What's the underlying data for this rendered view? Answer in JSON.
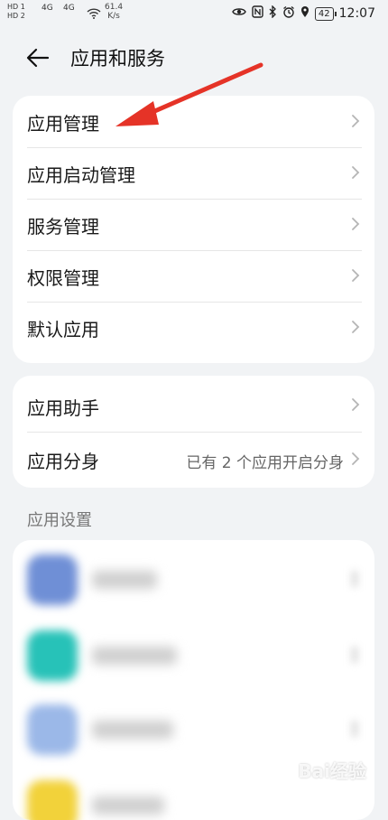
{
  "status_bar": {
    "left_tags": [
      "HD 1",
      "HD 2"
    ],
    "signal_labels": [
      "4G",
      "4G"
    ],
    "network_speed": "61.4",
    "network_unit": "K/s",
    "battery": "42",
    "time": "12:07",
    "icons": [
      "eye-icon",
      "nfc-icon",
      "bluetooth-icon",
      "alarm-icon",
      "location-icon",
      "battery-icon"
    ]
  },
  "header": {
    "title": "应用和服务",
    "back_icon": "arrow-left-icon"
  },
  "group1": {
    "items": [
      {
        "label": "应用管理"
      },
      {
        "label": "应用启动管理"
      },
      {
        "label": "服务管理"
      },
      {
        "label": "权限管理"
      },
      {
        "label": "默认应用"
      }
    ]
  },
  "group2": {
    "items": [
      {
        "label": "应用助手",
        "value": ""
      },
      {
        "label": "应用分身",
        "value": "已有 2 个应用开启分身"
      }
    ]
  },
  "app_settings": {
    "title": "应用设置",
    "icon_colors": [
      "#6f8fd6",
      "#27c2b8",
      "#9bb8e8",
      "#f2d23a"
    ]
  },
  "annotation": {
    "arrow_color": "#e53327"
  },
  "watermark": "Bai经验"
}
